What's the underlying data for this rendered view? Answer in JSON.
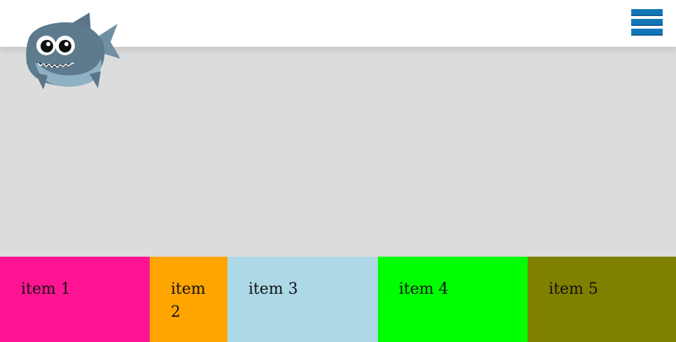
{
  "header": {
    "logo": {
      "icon": "shark-icon"
    },
    "menu": {
      "icon": "hamburger-menu-icon",
      "color": "#1277b8"
    }
  },
  "colors": {
    "background": "#dcdcdc",
    "header_background": "#ffffff"
  },
  "items": [
    {
      "label": "item 1",
      "color": "#ff1493"
    },
    {
      "label": "item 2",
      "color": "#ffa500"
    },
    {
      "label": "item 3",
      "color": "#add8e6"
    },
    {
      "label": "item 4",
      "color": "#00ff00"
    },
    {
      "label": "item 5",
      "color": "#808000"
    }
  ]
}
